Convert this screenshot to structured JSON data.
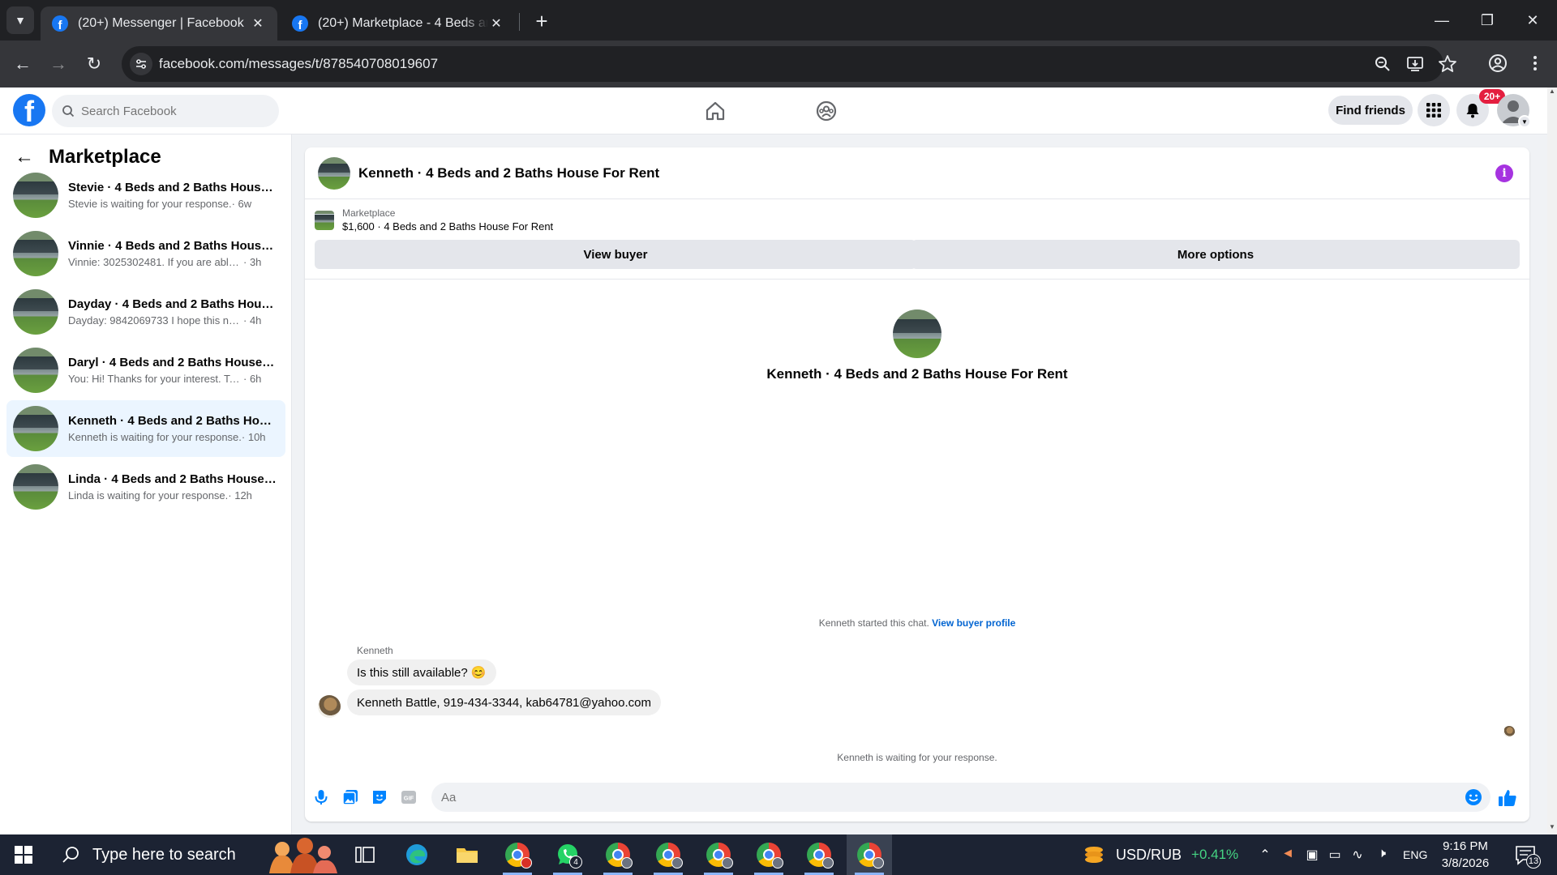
{
  "browser": {
    "tabs": [
      {
        "title": "(20+) Messenger | Facebook",
        "active": true
      },
      {
        "title": "(20+) Marketplace - 4 Beds and 2 Baths House For Rent",
        "active": false
      }
    ],
    "url": "facebook.com/messages/t/878540708019607"
  },
  "fb_header": {
    "search_placeholder": "Search Facebook",
    "find_friends_label": "Find friends",
    "notification_badge": "20+"
  },
  "sidebar": {
    "title": "Marketplace",
    "conversations": [
      {
        "name": "Stevie · 4 Beds and 2 Baths House For Rent",
        "preview": "Stevie is waiting for your response.",
        "time": " · 6w",
        "active": false
      },
      {
        "name": "Vinnie · 4 Beds and 2 Baths House For Rent",
        "preview": "Vinnie: 3025302481. If you are able to tour the house",
        "time": " · 3h",
        "active": false
      },
      {
        "name": "Dayday · 4 Beds and 2 Baths House For Rent",
        "preview": "Dayday: 9842069733 I hope this not a scam",
        "time": " · 4h",
        "active": false
      },
      {
        "name": "Daryl · 4 Beds and 2 Baths House For Rent",
        "preview": "You: Hi! Thanks for your interest. To show the house",
        "time": " · 6h",
        "active": false
      },
      {
        "name": "Kenneth · 4 Beds and 2 Baths House For Rent",
        "preview": "Kenneth is waiting for your response.",
        "time": " · 10h",
        "active": true
      },
      {
        "name": "Linda · 4 Beds and 2 Baths House For Rent",
        "preview": "Linda is waiting for your response.",
        "time": " · 12h",
        "active": false
      }
    ]
  },
  "chat": {
    "title": "Kenneth · 4 Beds and 2 Baths House For Rent",
    "listing_source": "Marketplace",
    "listing_name": "$1,600 · 4 Beds and 2 Baths House For Rent",
    "view_buyer_label": "View buyer",
    "more_options_label": "More options",
    "intro_title": "Kenneth · 4 Beds and 2 Baths House For Rent",
    "started_text": "Kenneth started this chat.",
    "view_profile_link": "View buyer profile",
    "sender_name": "Kenneth",
    "messages": [
      {
        "text": "Is this still available? 😊"
      },
      {
        "text": "Kenneth Battle, 919-434-3344, kab64781@yahoo.com"
      }
    ],
    "waiting_text": "Kenneth is waiting for your response.",
    "composer_placeholder": "Aa"
  },
  "taskbar": {
    "search_placeholder": "Type here to search",
    "whatsapp_badge": "4",
    "ticker_name": "USD/RUB",
    "ticker_change": "+0.41%",
    "language": "ENG",
    "time": "9:16 PM",
    "date": "3/8/2026",
    "notification_count": "13"
  },
  "colors": {
    "facebook_blue": "#1877f2",
    "messenger_blue": "#0084ff",
    "info_purple": "#a633e0",
    "notification_red": "#e41e3f",
    "ticker_green": "#45d483"
  }
}
